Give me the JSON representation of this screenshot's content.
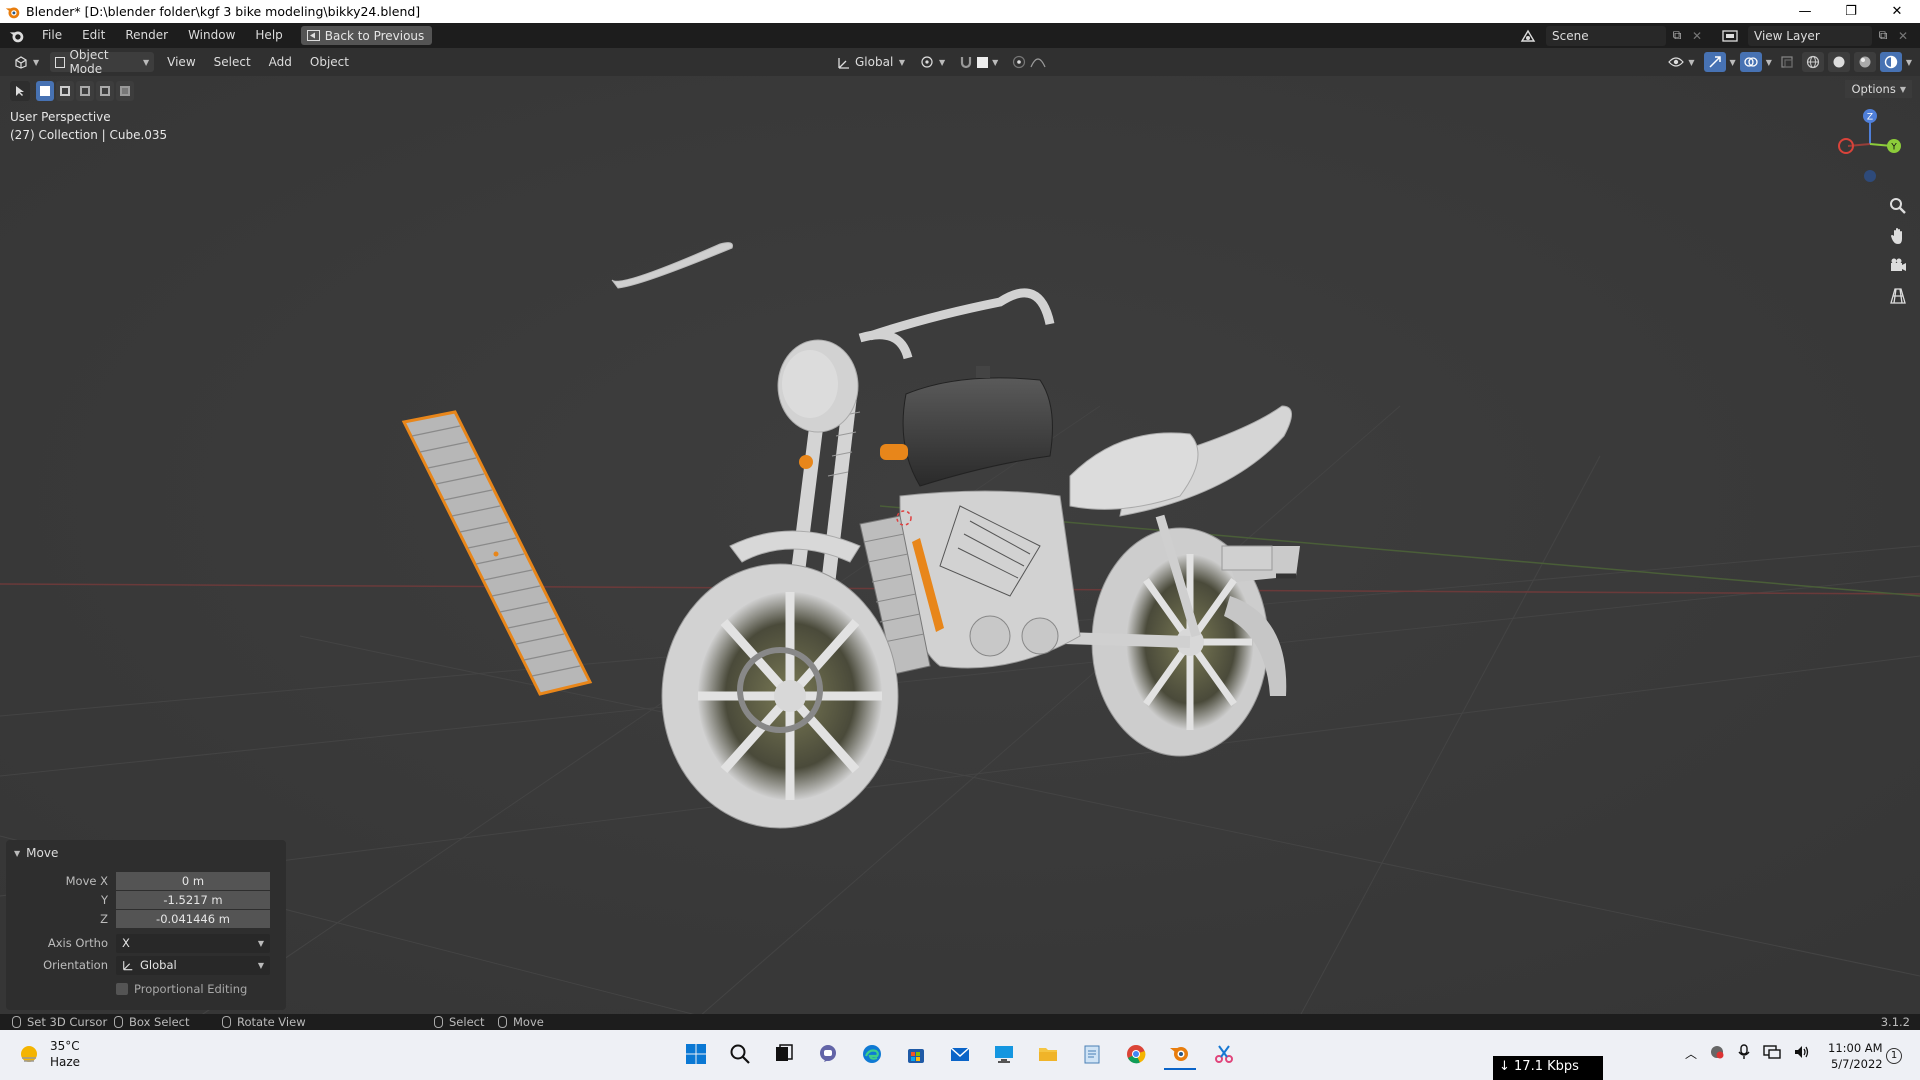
{
  "titlebar": {
    "title": "Blender* [D:\\blender folder\\kgf 3 bike modeling\\bikky24.blend]",
    "minimize": "—",
    "maximize": "❐",
    "close": "✕"
  },
  "menubar": {
    "items": [
      "File",
      "Edit",
      "Render",
      "Window",
      "Help"
    ],
    "back_button": "Back to Previous",
    "scene": "Scene",
    "view_layer": "View Layer"
  },
  "viewport_header": {
    "mode": "Object Mode",
    "menus": [
      "View",
      "Select",
      "Add",
      "Object"
    ],
    "orientation": "Global",
    "options": "Options"
  },
  "viewport": {
    "perspective": "User Perspective",
    "collection": "(27) Collection | Cube.035",
    "gizmo_axes": {
      "x": "X",
      "y": "Y",
      "z": "Z"
    },
    "colors": {
      "background": "#3b3b3b",
      "selection_outline": "#e8861a",
      "grid_red": "#7a3a3a",
      "grid_green": "#4e6e3a",
      "model": "#cfcfcf"
    }
  },
  "operator_panel": {
    "title": "Move",
    "rows": [
      {
        "label": "Move X",
        "value": "0 m"
      },
      {
        "label": "Y",
        "value": "-1.5217 m"
      },
      {
        "label": "Z",
        "value": "-0.041446 m"
      }
    ],
    "axis_ortho_label": "Axis Ortho",
    "axis_ortho_value": "X",
    "orientation_label": "Orientation",
    "orientation_value": "Global",
    "proportional_label": "Proportional Editing"
  },
  "statusbar": {
    "set_cursor": "Set 3D Cursor",
    "box_select": "Box Select",
    "rotate_view": "Rotate View",
    "select": "Select",
    "move": "Move",
    "version": "3.1.2"
  },
  "taskbar": {
    "temperature": "35°C",
    "condition": "Haze",
    "network": "↓ 17.1 Kbps",
    "time": "11:00 AM",
    "date": "5/7/2022",
    "notifications": "1"
  }
}
